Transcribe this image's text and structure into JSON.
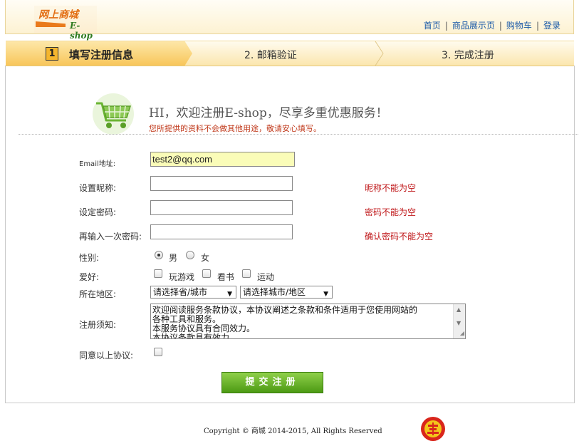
{
  "logo": {
    "cn": "网上商城",
    "en": "E-shop"
  },
  "nav": [
    {
      "label": "首页"
    },
    {
      "label": "商品展示页"
    },
    {
      "label": "购物车"
    },
    {
      "label": "登录"
    }
  ],
  "steps": [
    {
      "num": "1",
      "label": "填写注册信息",
      "active": true
    },
    {
      "label": "2. 邮箱验证"
    },
    {
      "label": "3. 完成注册"
    }
  ],
  "welcome": {
    "title": "HI，欢迎注册E-shop，尽享多重优惠服务！",
    "note": "您所提供的资料不会做其他用途，敬请安心填写。"
  },
  "form": {
    "email": {
      "label": "Email地址:",
      "value": "test2@qq.com"
    },
    "nickname": {
      "label": "设置昵称:",
      "value": "",
      "error": "昵称不能为空"
    },
    "password": {
      "label": "设定密码:",
      "value": "",
      "error": "密码不能为空"
    },
    "confirm": {
      "label": "再输入一次密码:",
      "value": "",
      "error": "确认密码不能为空"
    },
    "gender": {
      "label": "性别:",
      "options": [
        "男",
        "女"
      ],
      "selected": "男"
    },
    "hobby": {
      "label": "爱好:",
      "options": [
        "玩游戏",
        "看书",
        "运动"
      ]
    },
    "region": {
      "label": "所在地区:",
      "province": "请选择省/城市",
      "city": "请选择城市/地区"
    },
    "terms": {
      "label": "注册须知:",
      "lines": [
        "欢迎阅读服务条款协议，本协议阐述之条款和条件适用于您使用网站的",
        "各种工具和服务。",
        "本服务协议具有合同效力。",
        "本协议条款具有效力。"
      ]
    },
    "agree": {
      "label": "同意以上协议:"
    },
    "submit": "提交注册"
  },
  "footer": "Copyright © 商城 2014-2015, All Rights Reserved",
  "colors": {
    "accent": "#f5b62e",
    "error": "#c0191b",
    "link": "#1b5aa8",
    "submit": "#5aa81a"
  }
}
